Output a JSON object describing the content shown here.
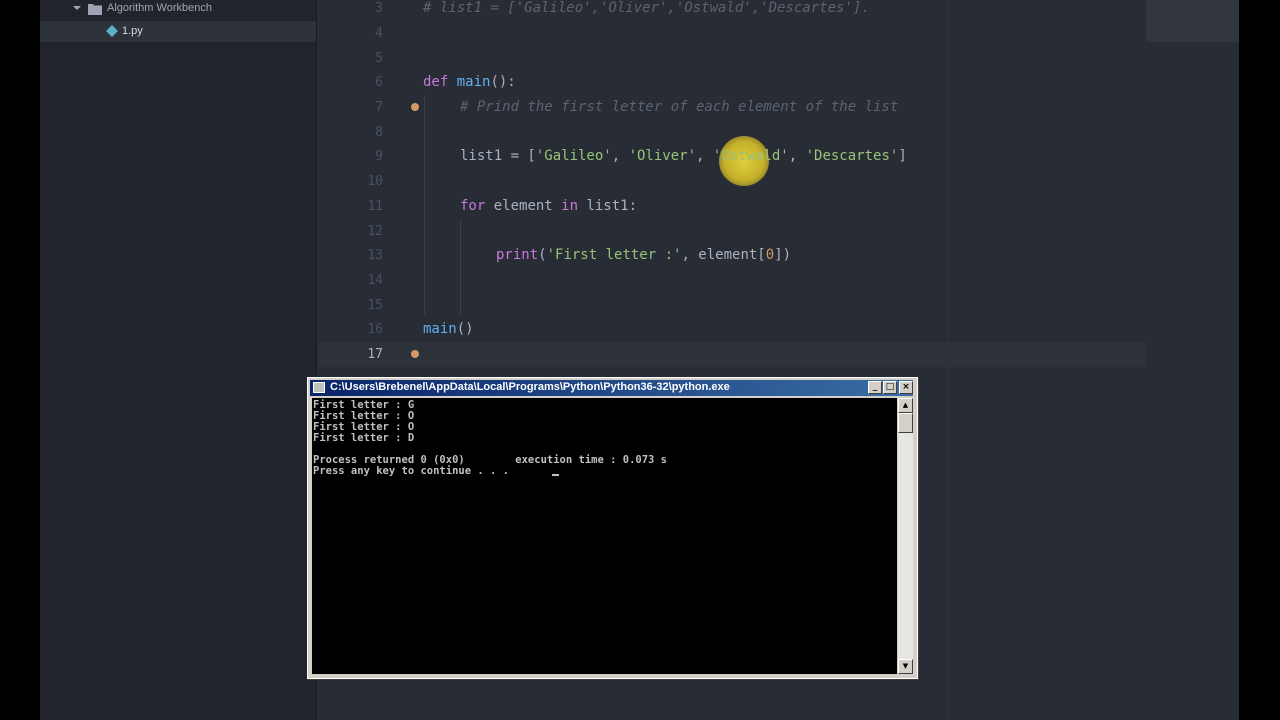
{
  "tree": {
    "folder_label": "Algorithm Workbench",
    "file_label": "1.py"
  },
  "editor": {
    "line_numbers": [
      "3",
      "4",
      "5",
      "6",
      "7",
      "8",
      "9",
      "10",
      "11",
      "12",
      "13",
      "14",
      "15",
      "16",
      "17"
    ],
    "current_line": "17",
    "line3": {
      "comment": "# list1 = ['Galileo','Oliver','Ostwald','Descartes']."
    },
    "line6": {
      "kw": "def",
      "fn": "main",
      "rest": "():"
    },
    "line7": {
      "comment": "# Prind the first letter of each element of the list"
    },
    "line9": {
      "var": "list1 = [",
      "s1": "'Galileo'",
      "c1": ", ",
      "s2": "'Oliver'",
      "c2": ", ",
      "s3": "'Ostwald'",
      "c3": ", ",
      "s4": "'Descartes'",
      "end": "]"
    },
    "line11": {
      "kw1": "for",
      "mid": " element ",
      "kw2": "in",
      "rest": " list1:"
    },
    "line13": {
      "fn": "print",
      "open": "(",
      "str": "'First letter :'",
      "mid": ", element[",
      "num": "0",
      "close": "])"
    },
    "line16": {
      "fn": "main",
      "rest": "()"
    }
  },
  "console": {
    "title": "C:\\Users\\Brebenel\\AppData\\Local\\Programs\\Python\\Python36-32\\python.exe",
    "minimize": "_",
    "maximize": "□",
    "close": "×",
    "scroll_up": "▲",
    "scroll_down": "▼",
    "lines": [
      "First letter : G",
      "First letter : O",
      "First letter : O",
      "First letter : D",
      "",
      "Process returned 0 (0x0)        execution time : 0.073 s",
      "Press any key to continue . . ."
    ]
  },
  "colors": {
    "editor_bg": "#282c34",
    "keyword": "#c678dd",
    "function": "#61afef",
    "string": "#98c379",
    "number": "#d19a66",
    "comment": "#5c6370",
    "console_titlebar": "#0a246a"
  }
}
